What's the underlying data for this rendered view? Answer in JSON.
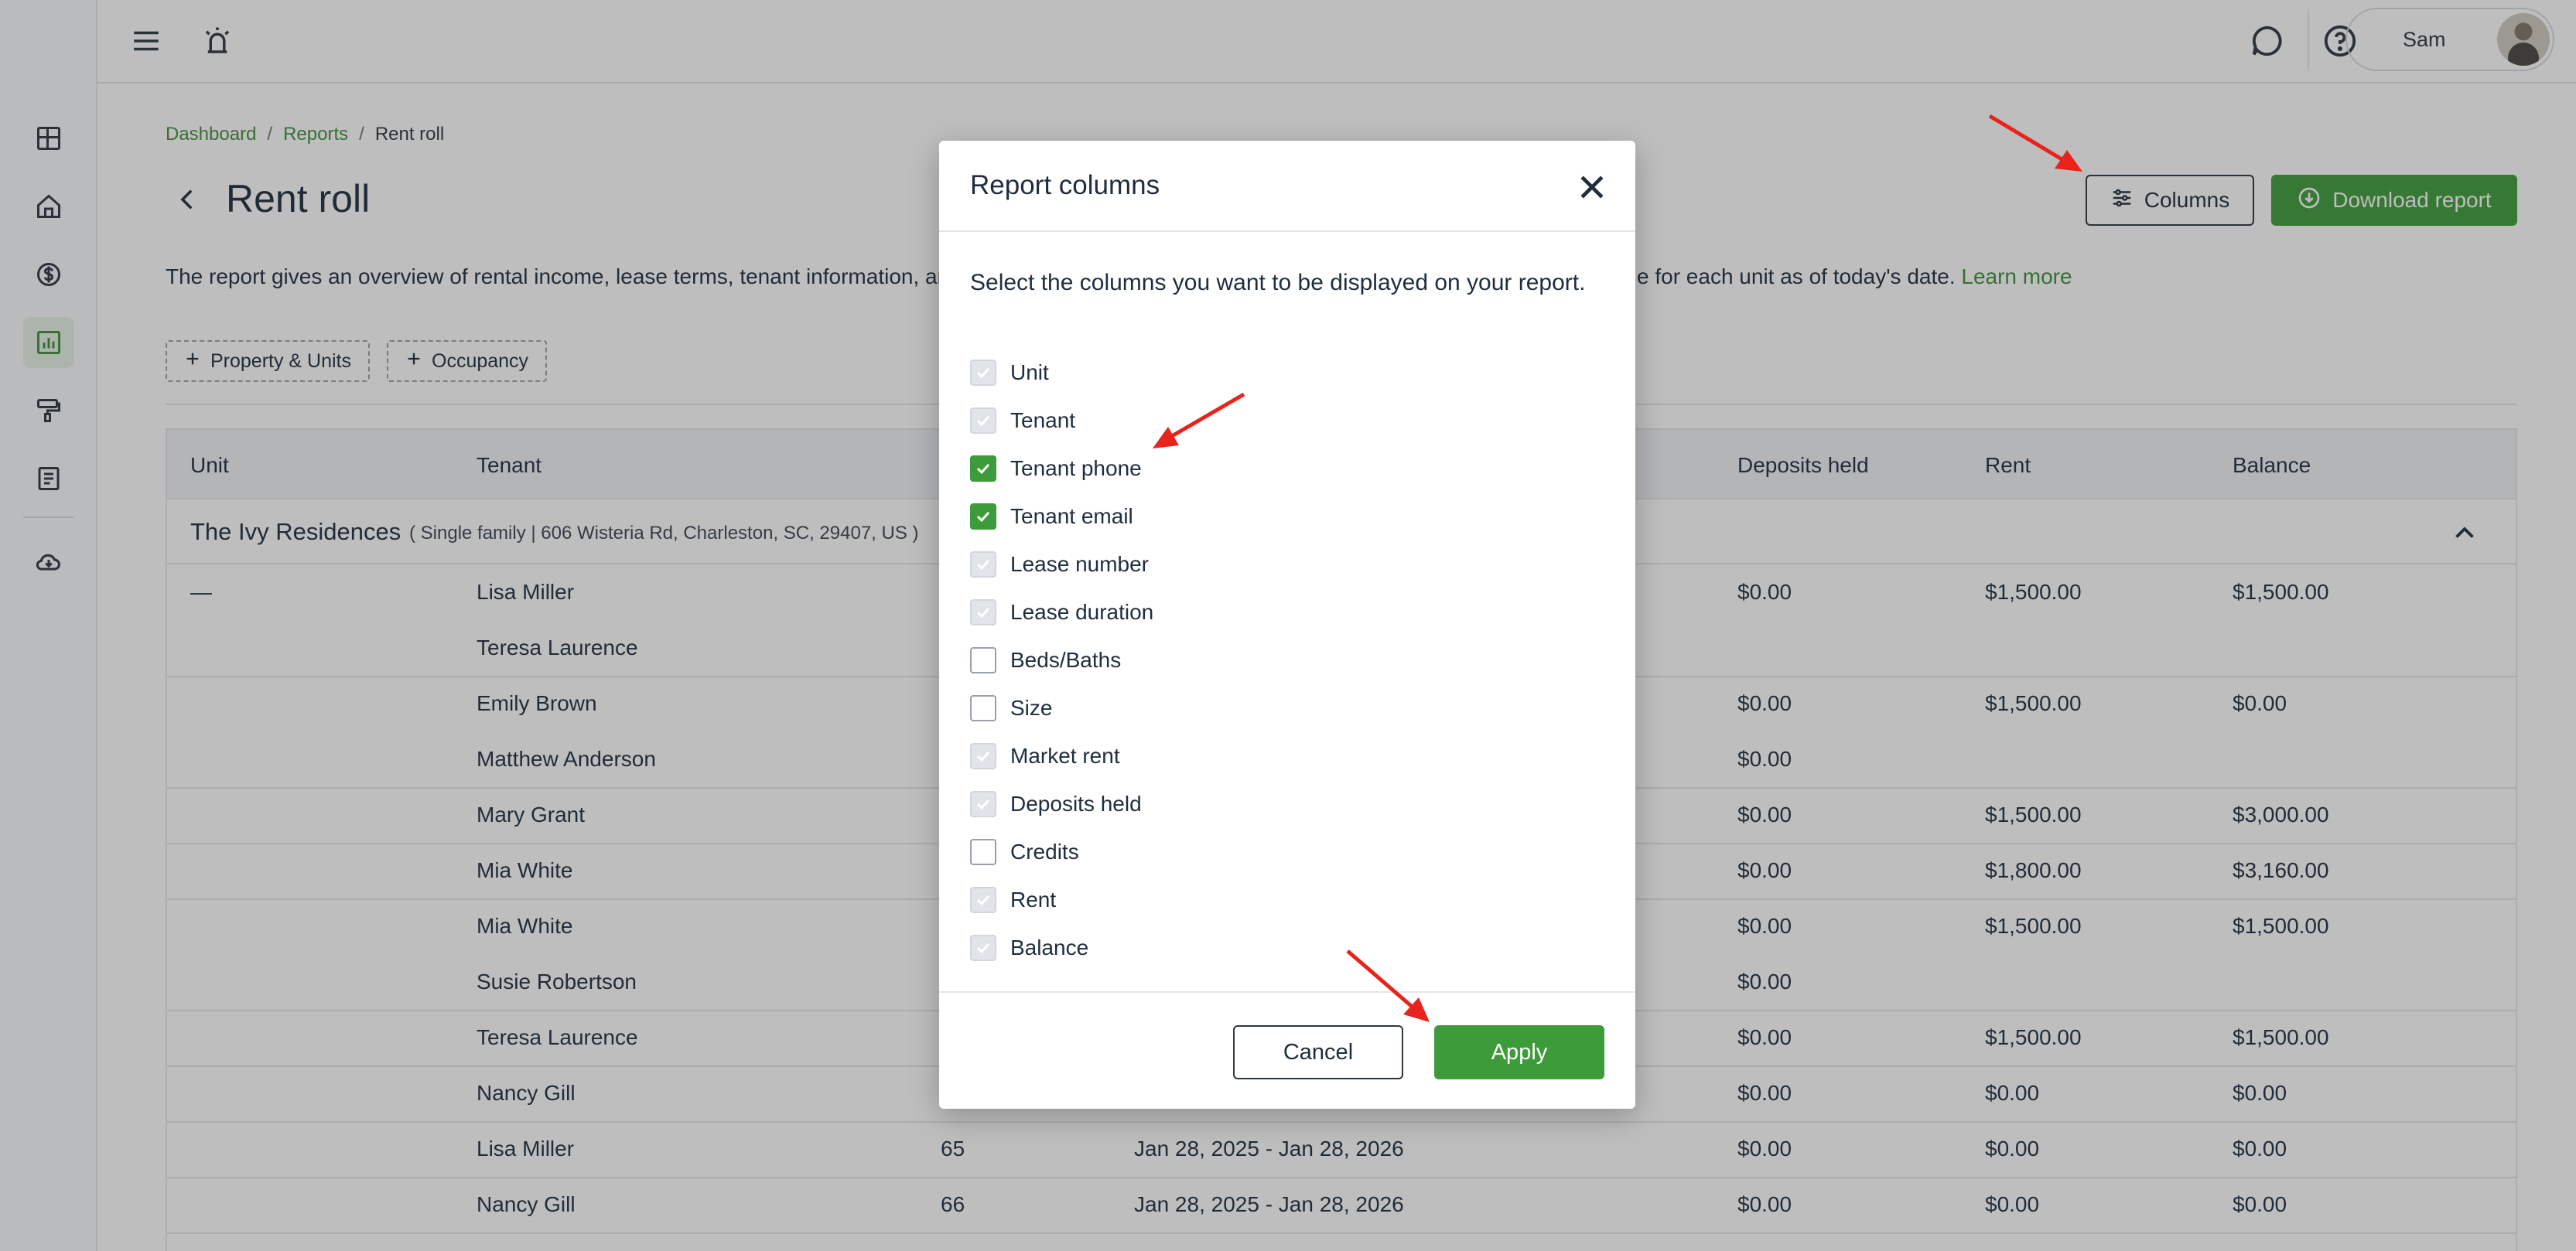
{
  "colors": {
    "brand_green": "#3e9b3a",
    "annotation_red": "#e8231b"
  },
  "topbar": {
    "user_name": "Sam"
  },
  "sidebar": {
    "items": [
      "dashboard-icon",
      "home-icon",
      "dollar-icon",
      "reports-icon",
      "paint-roller-icon",
      "document-icon",
      "cloud-download-icon"
    ],
    "active": "reports-icon"
  },
  "breadcrumb": {
    "dashboard": "Dashboard",
    "reports": "Reports",
    "current": "Rent roll",
    "sep": "/"
  },
  "page": {
    "title": "Rent roll",
    "columns_button": "Columns",
    "download_button": "Download report",
    "description_start": "The report gives an overview of rental income, lease terms, tenant information, an",
    "description_end": "e for each unit as of today's date.",
    "learn_more": "Learn more"
  },
  "filters": [
    "Property & Units",
    "Occupancy"
  ],
  "table": {
    "headers": {
      "unit": "Unit",
      "tenant": "Tenant",
      "deposits": "Deposits held",
      "rent": "Rent",
      "balance": "Balance"
    },
    "group": {
      "name": "The Ivy Residences",
      "meta": "( Single family | 606 Wisteria Rd, Charleston, SC, 29407, US )"
    },
    "rows": [
      {
        "unit": "—",
        "tenant": "Lisa Miller",
        "lease_no": "",
        "lease": "",
        "deposits": "$0.00",
        "rent": "$1,500.00",
        "balance": "$1,500.00"
      },
      {
        "unit": "",
        "tenant": "Teresa Laurence",
        "lease_no": "",
        "lease": "",
        "deposits": "",
        "rent": "",
        "balance": ""
      },
      {
        "unit": "",
        "tenant": "Emily Brown",
        "lease_no": "",
        "lease": "",
        "deposits": "$0.00",
        "rent": "$1,500.00",
        "balance": "$0.00"
      },
      {
        "unit": "",
        "tenant": "Matthew Anderson",
        "lease_no": "",
        "lease": "",
        "deposits": "$0.00",
        "rent": "",
        "balance": ""
      },
      {
        "unit": "",
        "tenant": "Mary Grant",
        "lease_no": "",
        "lease": "",
        "deposits": "$0.00",
        "rent": "$1,500.00",
        "balance": "$3,000.00"
      },
      {
        "unit": "",
        "tenant": "Mia White",
        "lease_no": "",
        "lease": "",
        "deposits": "$0.00",
        "rent": "$1,800.00",
        "balance": "$3,160.00"
      },
      {
        "unit": "",
        "tenant": "Mia White",
        "lease_no": "",
        "lease": "",
        "deposits": "$0.00",
        "rent": "$1,500.00",
        "balance": "$1,500.00"
      },
      {
        "unit": "",
        "tenant": "Susie Robertson",
        "lease_no": "",
        "lease": "",
        "deposits": "$0.00",
        "rent": "",
        "balance": ""
      },
      {
        "unit": "",
        "tenant": "Teresa Laurence",
        "lease_no": "",
        "lease": "",
        "deposits": "$0.00",
        "rent": "$1,500.00",
        "balance": "$1,500.00"
      },
      {
        "unit": "",
        "tenant": "Nancy Gill",
        "lease_no": "",
        "lease": "",
        "deposits": "$0.00",
        "rent": "$0.00",
        "balance": "$0.00"
      },
      {
        "unit": "",
        "tenant": "Lisa Miller",
        "lease_no": "65",
        "lease": "Jan 28, 2025 - Jan 28, 2026",
        "deposits": "$0.00",
        "rent": "$0.00",
        "balance": "$0.00"
      },
      {
        "unit": "",
        "tenant": "Nancy Gill",
        "lease_no": "66",
        "lease": "Jan 28, 2025 - Jan 28, 2026",
        "deposits": "$0.00",
        "rent": "$0.00",
        "balance": "$0.00"
      }
    ]
  },
  "modal": {
    "title": "Report columns",
    "instructions": "Select the columns you want to be displayed on your report.",
    "options": [
      {
        "label": "Unit",
        "state": "locked"
      },
      {
        "label": "Tenant",
        "state": "locked"
      },
      {
        "label": "Tenant phone",
        "state": "checked"
      },
      {
        "label": "Tenant email",
        "state": "checked"
      },
      {
        "label": "Lease number",
        "state": "locked"
      },
      {
        "label": "Lease duration",
        "state": "locked"
      },
      {
        "label": "Beds/Baths",
        "state": "unchecked"
      },
      {
        "label": "Size",
        "state": "unchecked"
      },
      {
        "label": "Market rent",
        "state": "locked"
      },
      {
        "label": "Deposits held",
        "state": "locked"
      },
      {
        "label": "Credits",
        "state": "unchecked"
      },
      {
        "label": "Rent",
        "state": "locked"
      },
      {
        "label": "Balance",
        "state": "locked"
      }
    ],
    "cancel": "Cancel",
    "apply": "Apply"
  }
}
